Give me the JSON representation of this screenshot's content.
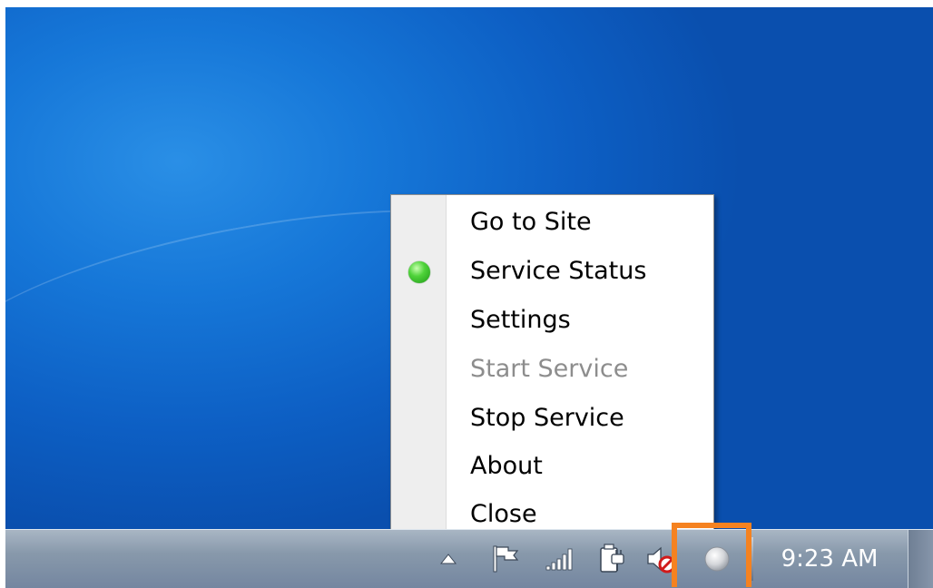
{
  "context_menu": {
    "items": [
      {
        "label": "Go to Site",
        "enabled": true
      },
      {
        "label": "Service Status",
        "enabled": true,
        "status_icon": "green-status-dot"
      },
      {
        "label": "Settings",
        "enabled": true
      },
      {
        "label": "Start Service",
        "enabled": false
      },
      {
        "label": "Stop Service",
        "enabled": true
      },
      {
        "label": "About",
        "enabled": true
      },
      {
        "label": "Close",
        "enabled": true
      }
    ]
  },
  "taskbar": {
    "clock": "9:23 AM",
    "tray_icons": [
      "show-hidden-icons-arrow",
      "action-center-flag-icon",
      "network-signal-icon",
      "power-plug-icon",
      "volume-muted-icon",
      "app-tray-icon"
    ]
  },
  "colors": {
    "highlight_box": "#f58220",
    "status_green": "#4fd33a",
    "disabled_text": "#8d8d8d"
  }
}
